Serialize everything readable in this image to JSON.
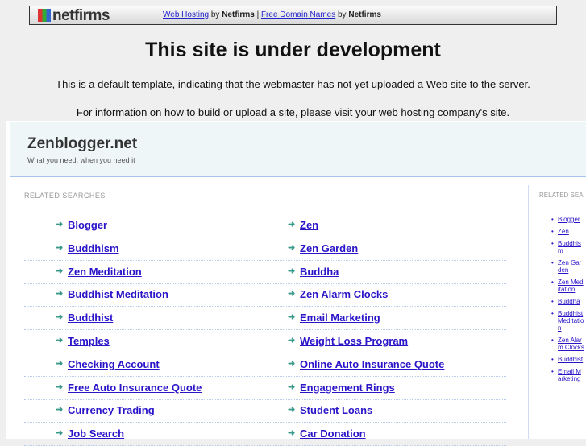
{
  "topbar": {
    "logo": "netfirms",
    "link1": "Web Hosting",
    "by1": "by",
    "brand1": "Netfirms",
    "pipe": "|",
    "link2": "Free Domain Names",
    "by2": "by",
    "brand2": "Netfirms"
  },
  "heading": "This site is under development",
  "para1": "This is a default template, indicating that the webmaster has not yet uploaded a Web site to the server.",
  "para2": "For information on how to build or upload a site, please visit your web hosting company's site.",
  "site": {
    "title": "Zenblogger.net",
    "tagline": "What you need, when you need it"
  },
  "related_label": "RELATED SEARCHES",
  "right_label": "RELATED SEA",
  "left_col": [
    "Blogger",
    "Buddhism",
    "Zen Meditation",
    "Buddhist Meditation",
    "Buddhist",
    "Temples",
    "Checking Account",
    "Free Auto Insurance Quote",
    "Currency Trading",
    "Job Search"
  ],
  "right_col": [
    "Zen",
    "Zen Garden",
    "Buddha",
    "Zen Alarm Clocks",
    "Email Marketing",
    "Weight Loss Program",
    "Online Auto Insurance Quote",
    "Engagement Rings",
    "Student Loans",
    "Car Donation"
  ],
  "side_list": [
    "Blogger",
    "Zen",
    "Buddhism",
    "Zen Garden",
    "Zen Meditation",
    "Buddha",
    "Buddhist Meditation",
    "Zen Alarm Clocks",
    "Buddhist",
    "Email Marketing"
  ]
}
